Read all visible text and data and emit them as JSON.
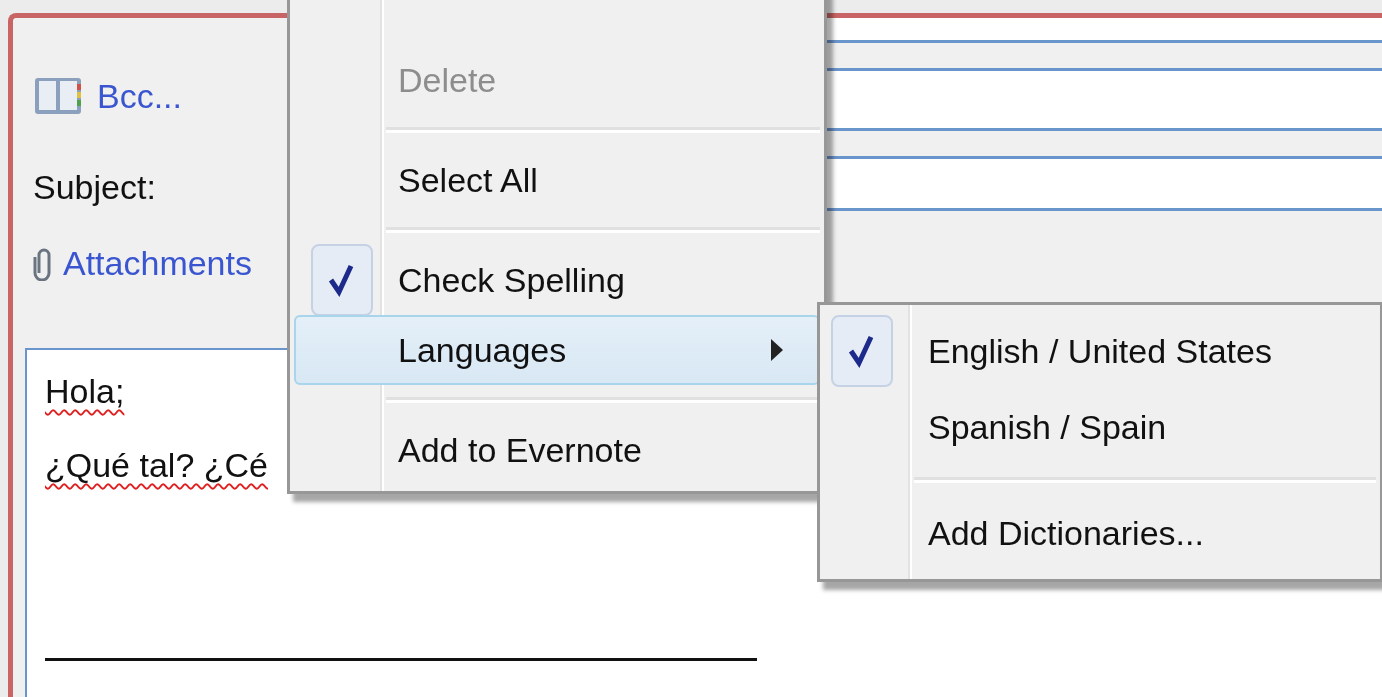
{
  "compose": {
    "bcc_link": "Bcc...",
    "subject_label": "Subject:",
    "attachments_link": "Attachments",
    "body": {
      "lines": [
        {
          "text": "Hola;",
          "misspelled": true
        },
        {
          "text": "¿Qué tal? ¿Cé",
          "misspelled": true
        }
      ],
      "signature_rule": true
    }
  },
  "context_menu": {
    "items": [
      {
        "kind": "item",
        "label": "Delete",
        "disabled": true,
        "checked": false,
        "selected": false,
        "submenu": false
      },
      {
        "kind": "separator"
      },
      {
        "kind": "item",
        "label": "Select All",
        "disabled": false,
        "checked": false,
        "selected": false,
        "submenu": false
      },
      {
        "kind": "separator"
      },
      {
        "kind": "item",
        "label": "Check Spelling",
        "disabled": false,
        "checked": true,
        "selected": false,
        "submenu": false
      },
      {
        "kind": "item",
        "label": "Languages",
        "disabled": false,
        "checked": false,
        "selected": true,
        "submenu": true
      },
      {
        "kind": "separator"
      },
      {
        "kind": "item",
        "label": "Add to Evernote",
        "disabled": false,
        "checked": false,
        "selected": false,
        "submenu": false
      }
    ]
  },
  "languages_submenu": {
    "items": [
      {
        "kind": "item",
        "label": "English / United States",
        "checked": true
      },
      {
        "kind": "item",
        "label": "Spanish / Spain",
        "checked": false
      },
      {
        "kind": "separator"
      },
      {
        "kind": "item",
        "label": "Add Dictionaries...",
        "checked": false
      }
    ]
  }
}
